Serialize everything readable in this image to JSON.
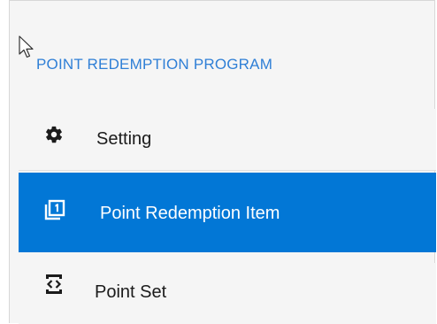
{
  "sidebar": {
    "section_title": "POINT REDEMPTION PROGRAM",
    "items": [
      {
        "label": "Setting",
        "icon": "gear-icon",
        "active": false
      },
      {
        "label": "Point Redemption Item",
        "icon": "numbered-pages-icon",
        "active": true
      },
      {
        "label": "Point Set",
        "icon": "code-brackets-icon",
        "active": false
      }
    ]
  },
  "colors": {
    "accent": "#0277d6",
    "section_title": "#2f7fd6",
    "panel_background": "#f5f5f5",
    "text": "#1b1b1b"
  }
}
